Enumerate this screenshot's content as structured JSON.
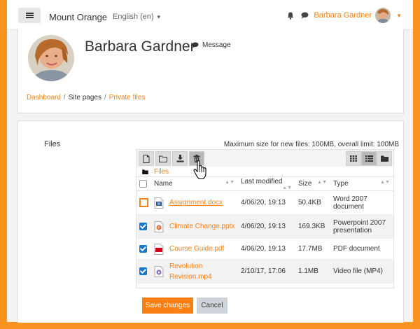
{
  "navbar": {
    "site_name": "Mount Orange",
    "language": "English (en)",
    "user_name": "Barbara Gardner"
  },
  "profile": {
    "name": "Barbara Gardner",
    "message_label": "Message"
  },
  "breadcrumb": {
    "items": [
      "Dashboard",
      "Site pages",
      "Private files"
    ]
  },
  "files": {
    "label": "Files",
    "max_size": "Maximum size for new files: 100MB, overall limit: 100MB",
    "path_label": "Files",
    "columns": [
      "Name",
      "Last modified",
      "Size",
      "Type"
    ],
    "rows": [
      {
        "name": "Assignment.docx",
        "modified": "4/06/20, 19:13",
        "size": "50.4KB",
        "type": "Word 2007 document",
        "checked": false
      },
      {
        "name": "Climate Change.pptx",
        "modified": "4/06/20, 19:13",
        "size": "169.3KB",
        "type": "Powerpoint 2007 presentation",
        "checked": true
      },
      {
        "name": "Course Guide.pdf",
        "modified": "4/06/20, 19:13",
        "size": "17.7MB",
        "type": "PDF document",
        "checked": true
      },
      {
        "name": "Revolution Revision.mp4",
        "modified": "2/10/17, 17:06",
        "size": "1.1MB",
        "type": "Video file (MP4)",
        "checked": true
      }
    ]
  },
  "actions": {
    "save": "Save changes",
    "cancel": "Cancel"
  },
  "colors": {
    "accent": "#f98012",
    "border": "#f7931e",
    "checkbox": "#1177d1"
  }
}
